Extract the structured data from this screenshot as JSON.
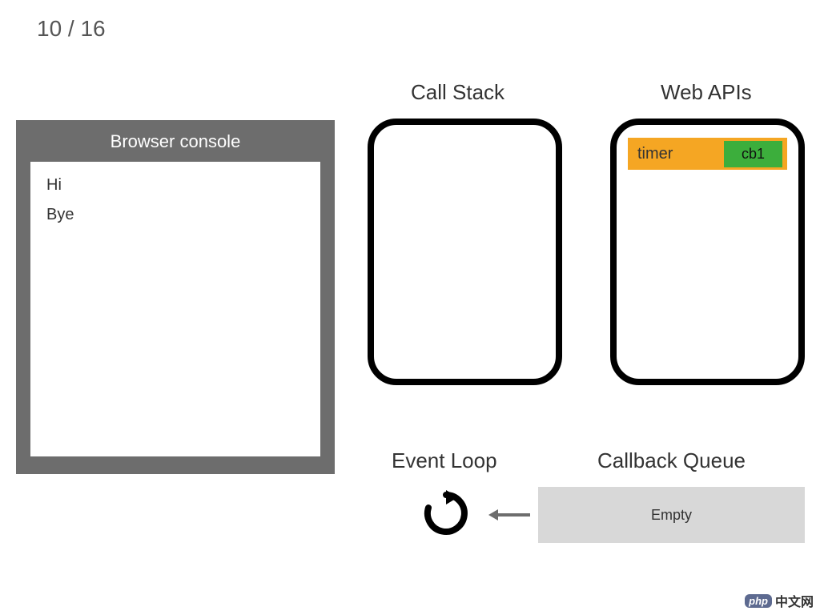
{
  "slide": {
    "counter": "10 / 16"
  },
  "console": {
    "title": "Browser console",
    "lines": [
      "Hi",
      "Bye"
    ]
  },
  "headings": {
    "callstack": "Call Stack",
    "webapis": "Web APIs",
    "eventloop": "Event Loop",
    "cbqueue": "Callback Queue"
  },
  "webapis": {
    "timer_label": "timer",
    "callback_label": "cb1"
  },
  "queue": {
    "status": "Empty"
  },
  "watermark": {
    "badge": "php",
    "text": "中文网"
  },
  "colors": {
    "panel_gray": "#6d6d6d",
    "timer_bg": "#f5a623",
    "cb_bg": "#3cae3c",
    "queue_bg": "#d8d8d8"
  }
}
